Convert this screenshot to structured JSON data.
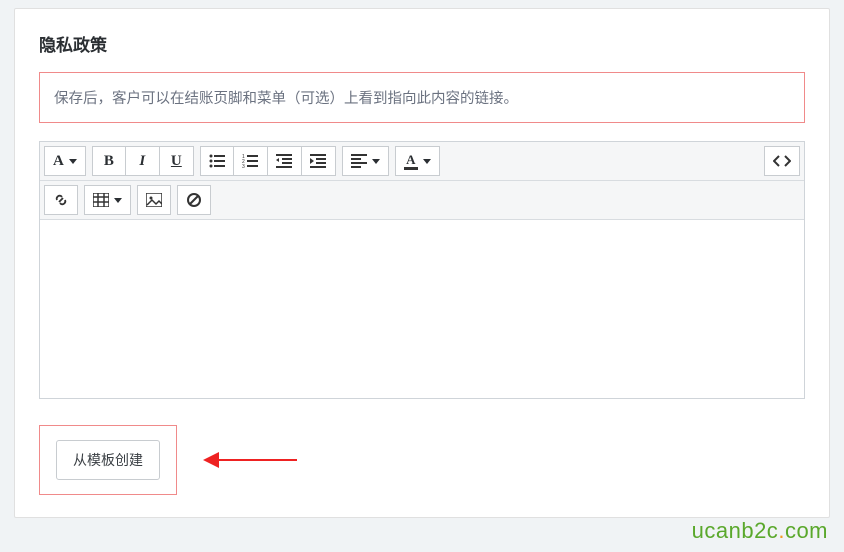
{
  "title": "隐私政策",
  "info_text": "保存后，客户可以在结账页脚和菜单（可选）上看到指向此内容的链接。",
  "toolbar": {
    "font_glyph": "A",
    "bold_glyph": "B",
    "italic_glyph": "I",
    "underline_glyph": "U",
    "bgcolor_glyph": "A"
  },
  "create_button_label": "从模板创建",
  "watermark": {
    "a": "ucanb2c",
    "b": ".",
    "c": "com"
  }
}
